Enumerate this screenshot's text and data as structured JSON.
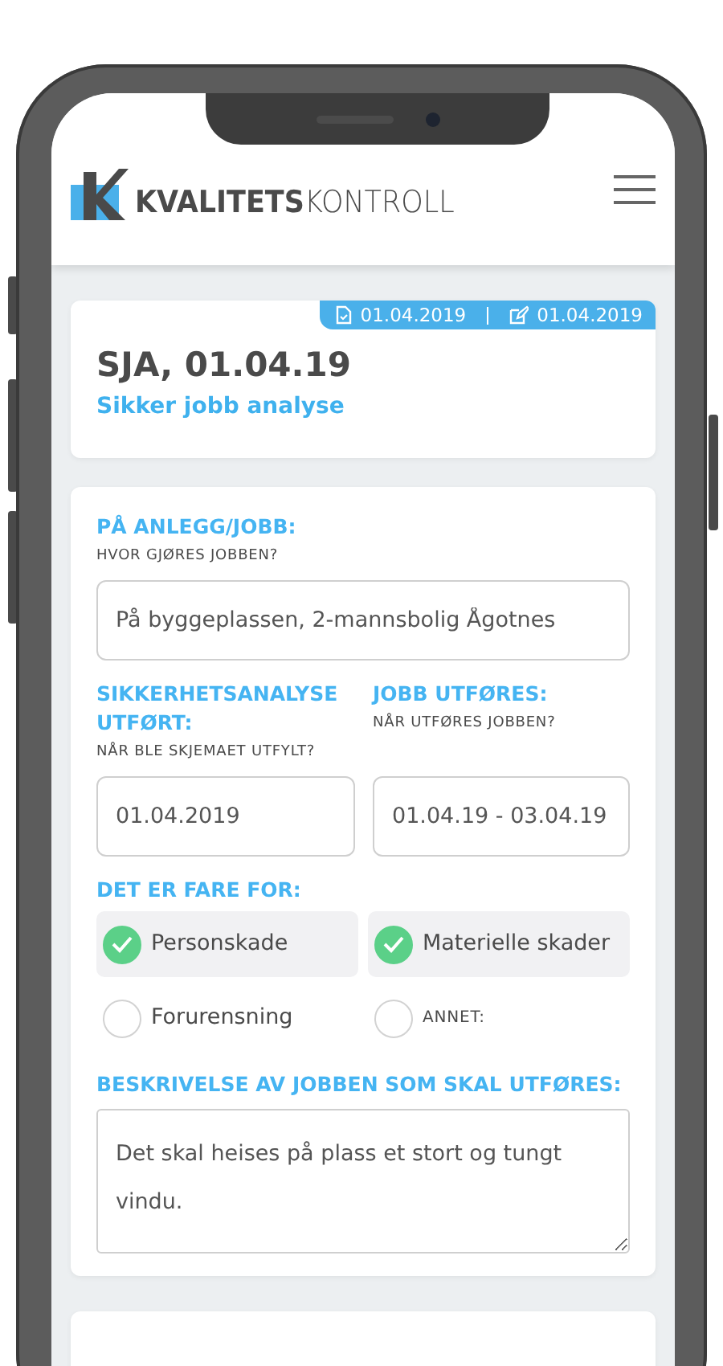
{
  "header": {
    "logo": "**KVALITETS**KONTROLL"
  },
  "summary": {
    "badges": [
      {
        "kind": "document",
        "text": "01.04.2019"
      },
      {
        "kind": "edit",
        "text": "01.04.2019"
      }
    ],
    "title": "SJA, 01.04.19",
    "subtitle": "Sikker jobb analyse"
  },
  "form": {
    "location": {
      "label": "PÅ ANLEGG/JOBB:",
      "hint": "HVOR GJØRES JOBBEN?",
      "value": "På byggeplassen, 2-mannsbolig Ågotnes"
    },
    "dates": [
      {
        "label": "SIKKERHETSANALYSE UTFØRT:",
        "hint": "NÅR BLE SKJEMAET UTFYLT?",
        "value": "01.04.2019"
      },
      {
        "label": "JOBB UTFØRES:",
        "hint": "NÅR UTFØRES JOBBEN?",
        "value": "01.04.19 - 03.04.19"
      }
    ],
    "hazards": {
      "label": "DET ER FARE FOR:",
      "options": [
        {
          "kind": "option",
          "label": "Personskade",
          "checked": true
        },
        {
          "kind": "option",
          "label": "Materielle skader",
          "checked": true
        },
        {
          "kind": "option",
          "label": "Forurensning",
          "checked": false
        },
        {
          "kind": "other",
          "label": "ANNET:",
          "checked": false
        }
      ]
    },
    "description": {
      "label": "BESKRIVELSE AV JOBBEN SOM SKAL UTFØRES:",
      "value": "Det skal heises på plass et stort og tungt vindu."
    }
  }
}
